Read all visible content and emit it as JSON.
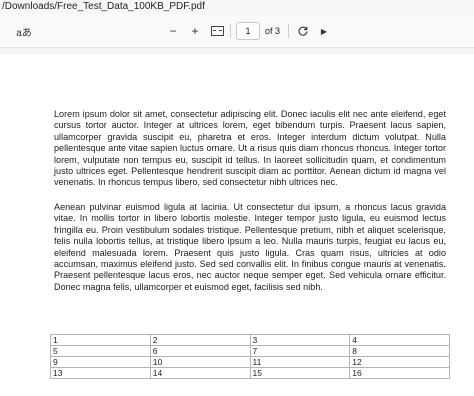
{
  "window": {
    "title": "/Downloads/Free_Test_Data_100KB_PDF.pdf"
  },
  "toolbar": {
    "read_aloud_label": "aあ",
    "zoom_out_symbol": "−",
    "zoom_in_symbol": "+",
    "page_current": "1",
    "page_total_label": "of 3"
  },
  "icons": {
    "read_aloud": "read-aloud-icon",
    "zoom_out": "minus-icon",
    "zoom_in": "plus-icon",
    "fit_page": "fit-page-icon",
    "rotate": "rotate-icon",
    "collapse": "chevron-icon"
  },
  "document": {
    "paragraphs": [
      "Lorem ipsum dolor sit amet, consectetur adipiscing elit. Donec iaculis elit nec ante eleifend, eget cursus tortor auctor. Integer at ultrices lorem, eget bibendum turpis. Praesent lacus sapien, ullamcorper gravida suscipit eu, pharetra et eros. Integer interdum dictum volutpat. Nulla pellentesque ante vitae sapien luctus ornare. Ut a risus quis diam rhoncus rhoncus. Integer tortor lorem, vulputate non tempus eu, suscipit id tellus. In laoreet sollicitudin quam, et condimentum justo ultrices eget. Pellentesque hendrerit suscipit diam ac porttitor. Aenean dictum id magna vel venenatis. In rhoncus tempus libero, sed consectetur nibh ultrices nec.",
      "Aenean pulvinar euismod ligula at lacinia. Ut consectetur dui ipsum, a rhoncus lacus gravida vitae. In mollis tortor in libero lobortis molestie. Integer tempor justo ligula, eu euismod lectus fringilla eu. Proin vestibulum sodales tristique. Pellentesque pretium, nibh et aliquet scelerisque, felis nulla lobortis tellus, at tristique libero ipsum a leo. Nulla mauris turpis, feugiat eu lacus eu, eleifend malesuada lorem. Praesent quis justo ligula. Cras quam risus, ultricies at odio accumsan, maximus eleifend justo. Sed sed convallis elit. In finibus congue mauris at venenatis. Praesent pellentesque lacus eros, nec auctor neque semper eget. Sed vehicula ornare efficitur. Donec magna felis, ullamcorper et euismod eget, facilisis sed nibh."
    ],
    "table": [
      [
        "1",
        "2",
        "3",
        "4"
      ],
      [
        "5",
        "6",
        "7",
        "8"
      ],
      [
        "9",
        "10",
        "11",
        "12"
      ],
      [
        "13",
        "14",
        "15",
        "16"
      ]
    ]
  }
}
